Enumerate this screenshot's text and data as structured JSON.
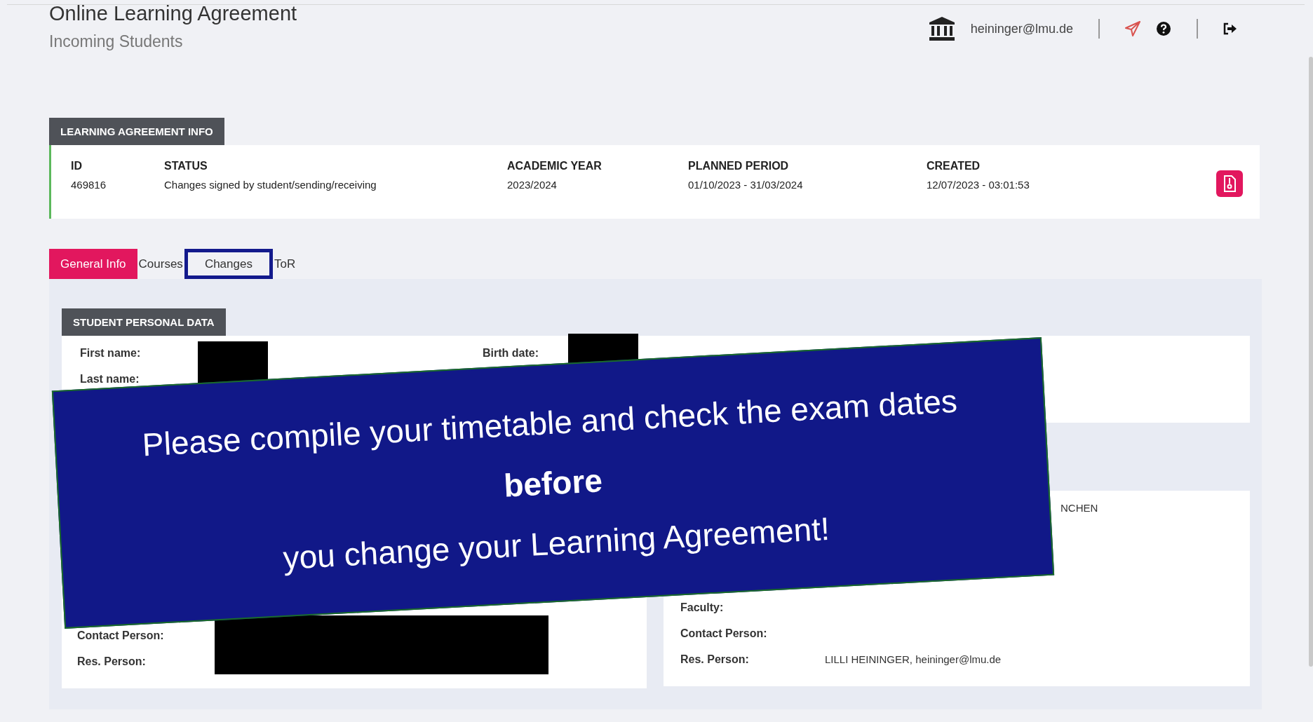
{
  "header": {
    "title": "Online Learning Agreement",
    "subtitle": "Incoming Students",
    "user_email": "heininger@lmu.de"
  },
  "info": {
    "title": "LEARNING AGREEMENT INFO",
    "columns": [
      {
        "label": "ID",
        "value": "469816"
      },
      {
        "label": "STATUS",
        "value": "Changes signed by student/sending/receiving"
      },
      {
        "label": "ACADEMIC YEAR",
        "value": "2023/2024"
      },
      {
        "label": "PLANNED PERIOD",
        "value": "01/10/2023 - 31/03/2024"
      },
      {
        "label": "CREATED",
        "value": "12/07/2023 - 03:01:53"
      }
    ]
  },
  "tabs": [
    {
      "label": "General Info",
      "selected": true,
      "highlighted": false
    },
    {
      "label": "Courses",
      "selected": false,
      "highlighted": false
    },
    {
      "label": "Changes",
      "selected": false,
      "highlighted": true
    },
    {
      "label": "ToR",
      "selected": false,
      "highlighted": false
    }
  ],
  "student": {
    "title": "STUDENT PERSONAL DATA",
    "fields": [
      {
        "label": "First name:",
        "redacted": true
      },
      {
        "label": "Last name:",
        "redacted": true
      },
      {
        "label": "Birth date:",
        "redacted": true
      }
    ]
  },
  "lower_left": {
    "rows": [
      {
        "label": "Contact Person:"
      },
      {
        "label": "Res. Person:",
        "redacted": true
      }
    ]
  },
  "lower_right": {
    "tail_value": "NCHEN",
    "rows": [
      {
        "label": "Faculty:"
      },
      {
        "label": "Contact Person:"
      },
      {
        "label": "Res. Person:",
        "value": "LILLI HEININGER, heininger@lmu.de"
      }
    ]
  },
  "banner": {
    "lines": [
      {
        "text": "Please compile your timetable and check the exam dates",
        "bold": false
      },
      {
        "text": "before",
        "bold": true
      },
      {
        "text": "you change your Learning Agreement!",
        "bold": false
      }
    ]
  }
}
